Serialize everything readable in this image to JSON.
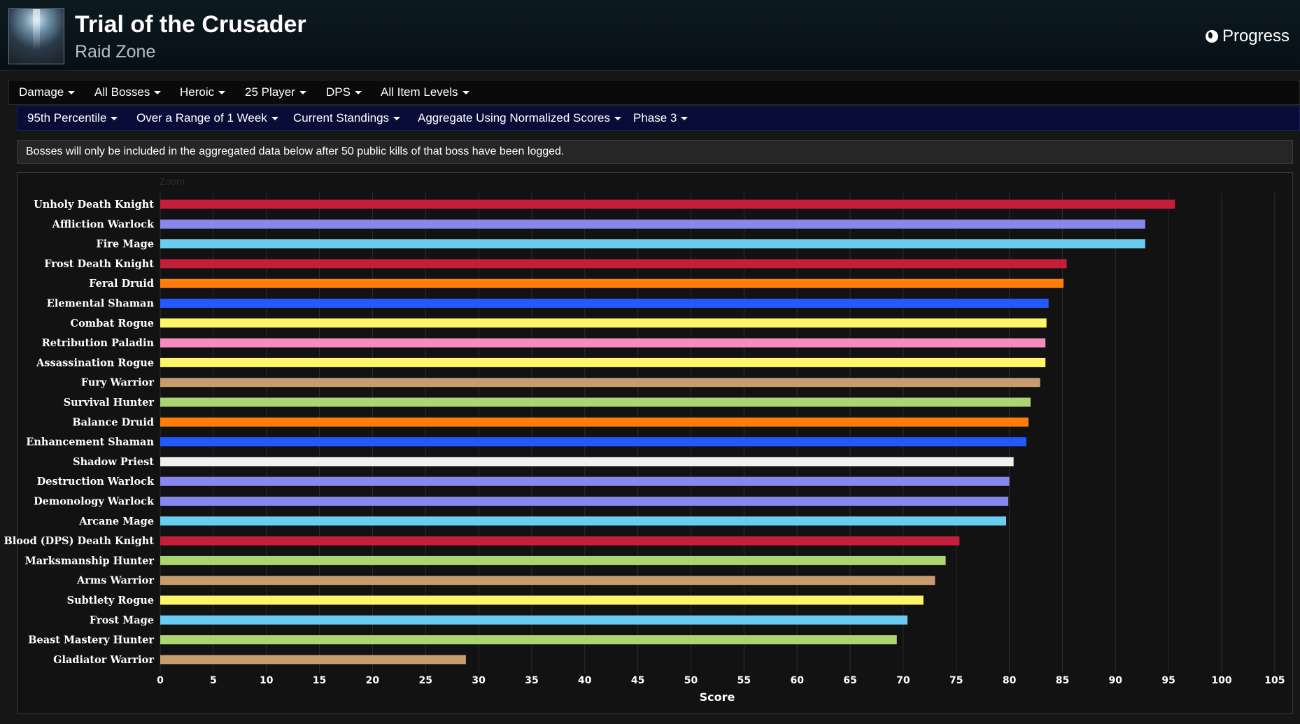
{
  "header": {
    "title": "Trial of the Crusader",
    "subtitle": "Raid Zone",
    "progress_label": "Progress"
  },
  "filters_row1": [
    "Damage",
    "All Bosses",
    "Heroic",
    "25 Player",
    "DPS",
    "All Item Levels"
  ],
  "filters_row2": [
    "95th Percentile",
    "Over a Range of 1 Week",
    "Current Standings",
    "Aggregate Using Normalized Scores",
    "Phase 3"
  ],
  "notice": "Bosses will only be included in the aggregated data below after 50 public kills of that boss have been logged.",
  "zoom_label": "Zoom",
  "chart_data": {
    "type": "bar",
    "orientation": "horizontal",
    "xlabel": "Score",
    "xlim": [
      0,
      105
    ],
    "xticks": [
      0,
      5,
      10,
      15,
      20,
      25,
      30,
      35,
      40,
      45,
      50,
      55,
      60,
      65,
      70,
      75,
      80,
      85,
      90,
      95,
      100,
      105
    ],
    "grid": true,
    "categories": [
      "Unholy Death Knight",
      "Affliction Warlock",
      "Fire Mage",
      "Frost Death Knight",
      "Feral Druid",
      "Elemental Shaman",
      "Combat Rogue",
      "Retribution Paladin",
      "Assassination Rogue",
      "Fury Warrior",
      "Survival Hunter",
      "Balance Druid",
      "Enhancement Shaman",
      "Shadow Priest",
      "Destruction Warlock",
      "Demonology Warlock",
      "Arcane Mage",
      "Blood (DPS) Death Knight",
      "Marksmanship Hunter",
      "Arms Warrior",
      "Subtlety Rogue",
      "Frost Mage",
      "Beast Mastery Hunter",
      "Gladiator Warrior"
    ],
    "values": [
      95.6,
      92.8,
      92.8,
      85.4,
      85.1,
      83.7,
      83.5,
      83.4,
      83.4,
      82.9,
      82.0,
      81.8,
      81.6,
      80.4,
      80.0,
      79.9,
      79.7,
      75.3,
      74.0,
      73.0,
      71.9,
      70.4,
      69.4,
      28.8
    ],
    "colors": [
      "#c41e3a",
      "#8787ed",
      "#69ccf0",
      "#c41e3a",
      "#ff7d0a",
      "#2459ff",
      "#fff569",
      "#f58cba",
      "#fff569",
      "#c79c6e",
      "#abd473",
      "#ff7d0a",
      "#2459ff",
      "#f0f0f0",
      "#8787ed",
      "#8787ed",
      "#69ccf0",
      "#c41e3a",
      "#abd473",
      "#c79c6e",
      "#fff569",
      "#69ccf0",
      "#abd473",
      "#c79c6e"
    ]
  }
}
